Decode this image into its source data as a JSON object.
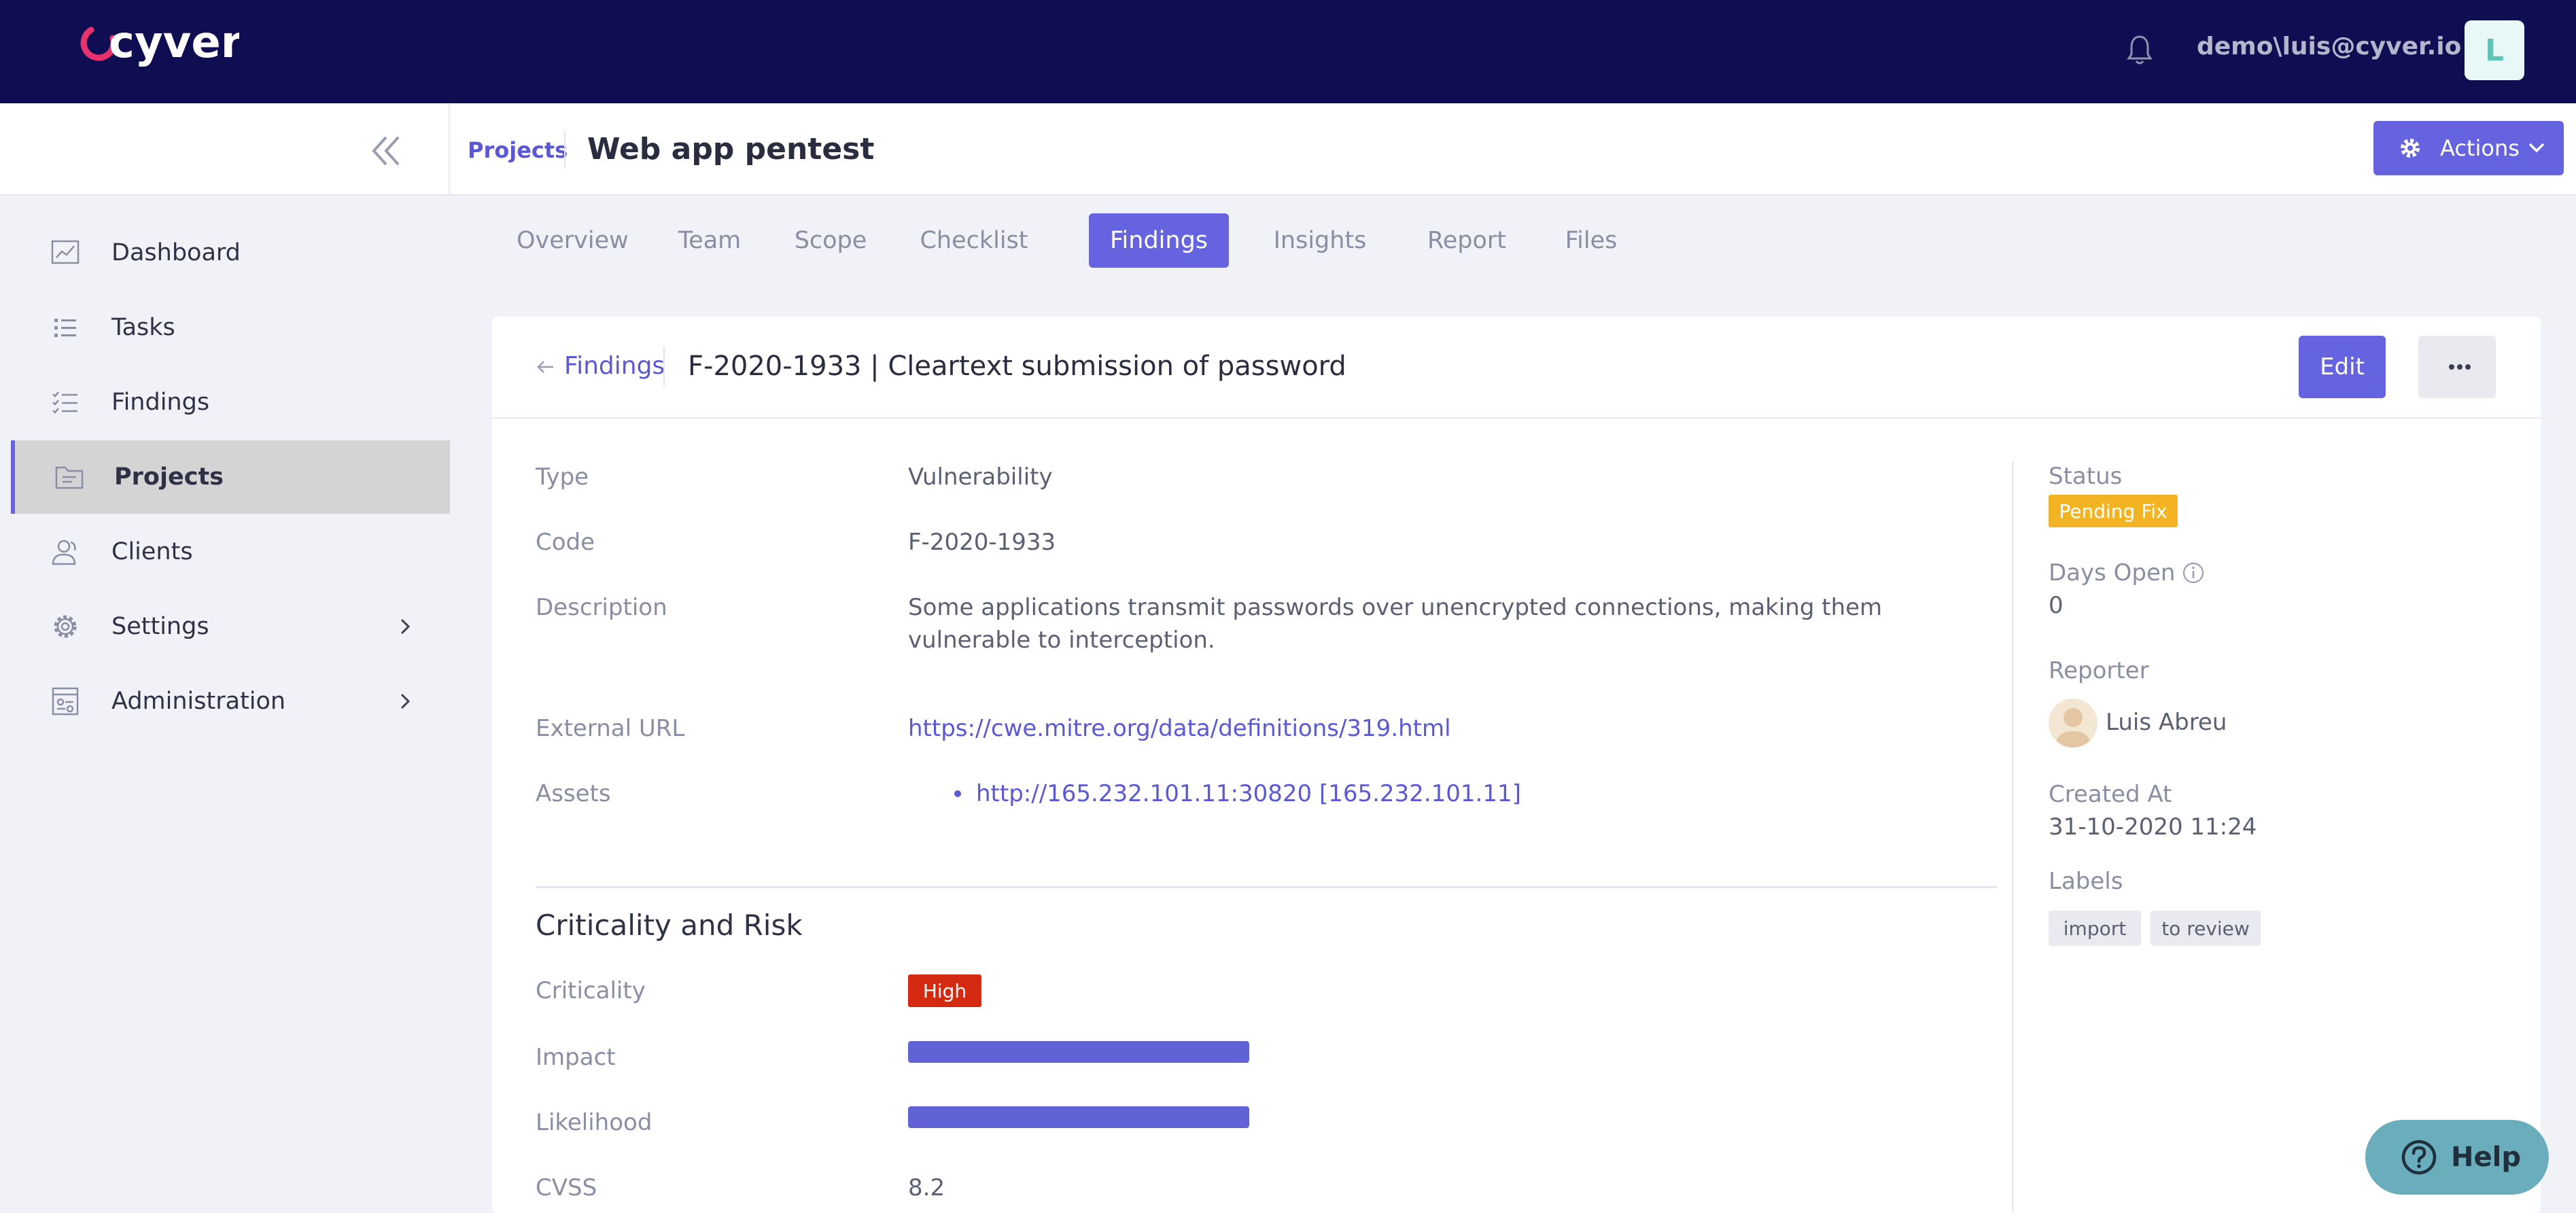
{
  "header": {
    "logo_text": "cyver",
    "user_label": "demo\\luis@cyver.io",
    "avatar_initial": "L"
  },
  "subheader": {
    "breadcrumb_projects": "Projects",
    "title": "Web app pentest",
    "actions_label": "Actions"
  },
  "sidebar": {
    "items": [
      {
        "label": "Dashboard",
        "icon": "chart-icon"
      },
      {
        "label": "Tasks",
        "icon": "list-icon"
      },
      {
        "label": "Findings",
        "icon": "checklist-icon"
      },
      {
        "label": "Projects",
        "icon": "folder-icon"
      },
      {
        "label": "Clients",
        "icon": "users-icon"
      },
      {
        "label": "Settings",
        "icon": "gear-icon"
      },
      {
        "label": "Administration",
        "icon": "admin-icon"
      }
    ],
    "active": "Projects"
  },
  "tabs": [
    {
      "label": "Overview"
    },
    {
      "label": "Team"
    },
    {
      "label": "Scope"
    },
    {
      "label": "Checklist"
    },
    {
      "label": "Findings"
    },
    {
      "label": "Insights"
    },
    {
      "label": "Report"
    },
    {
      "label": "Files"
    }
  ],
  "active_tab": "Findings",
  "finding": {
    "back_label": "Findings",
    "title": "F-2020-1933 | Cleartext submission of password",
    "edit_label": "Edit",
    "fields": {
      "type_label": "Type",
      "type_value": "Vulnerability",
      "code_label": "Code",
      "code_value": "F-2020-1933",
      "description_label": "Description",
      "description_value": "Some applications transmit passwords over unencrypted connections, making them vulnerable to interception.",
      "url_label": "External URL",
      "url_value": "https://cwe.mitre.org/data/definitions/319.html",
      "assets_label": "Assets",
      "assets": [
        "http://165.232.101.11:30820 [165.232.101.11]"
      ]
    },
    "risk": {
      "section_title": "Criticality and Risk",
      "criticality_label": "Criticality",
      "criticality_value": "High",
      "impact_label": "Impact",
      "impact_level": 1.0,
      "likelihood_label": "Likelihood",
      "likelihood_level": 1.0,
      "cvss_label": "CVSS",
      "cvss_value": "8.2"
    },
    "side": {
      "status_label": "Status",
      "status_value": "Pending Fix",
      "days_open_label": "Days Open",
      "days_open_value": "0",
      "reporter_label": "Reporter",
      "reporter_name": "Luis Abreu",
      "created_label": "Created At",
      "created_value": "31-10-2020 11:24",
      "labels_label": "Labels",
      "labels": [
        "import",
        "to review"
      ]
    }
  },
  "help_label": "Help",
  "colors": {
    "topbar": "#0f0e52",
    "accent": "#6663e0",
    "high": "#d42a12",
    "pending": "#f2b422",
    "help": "#6aaebd"
  }
}
